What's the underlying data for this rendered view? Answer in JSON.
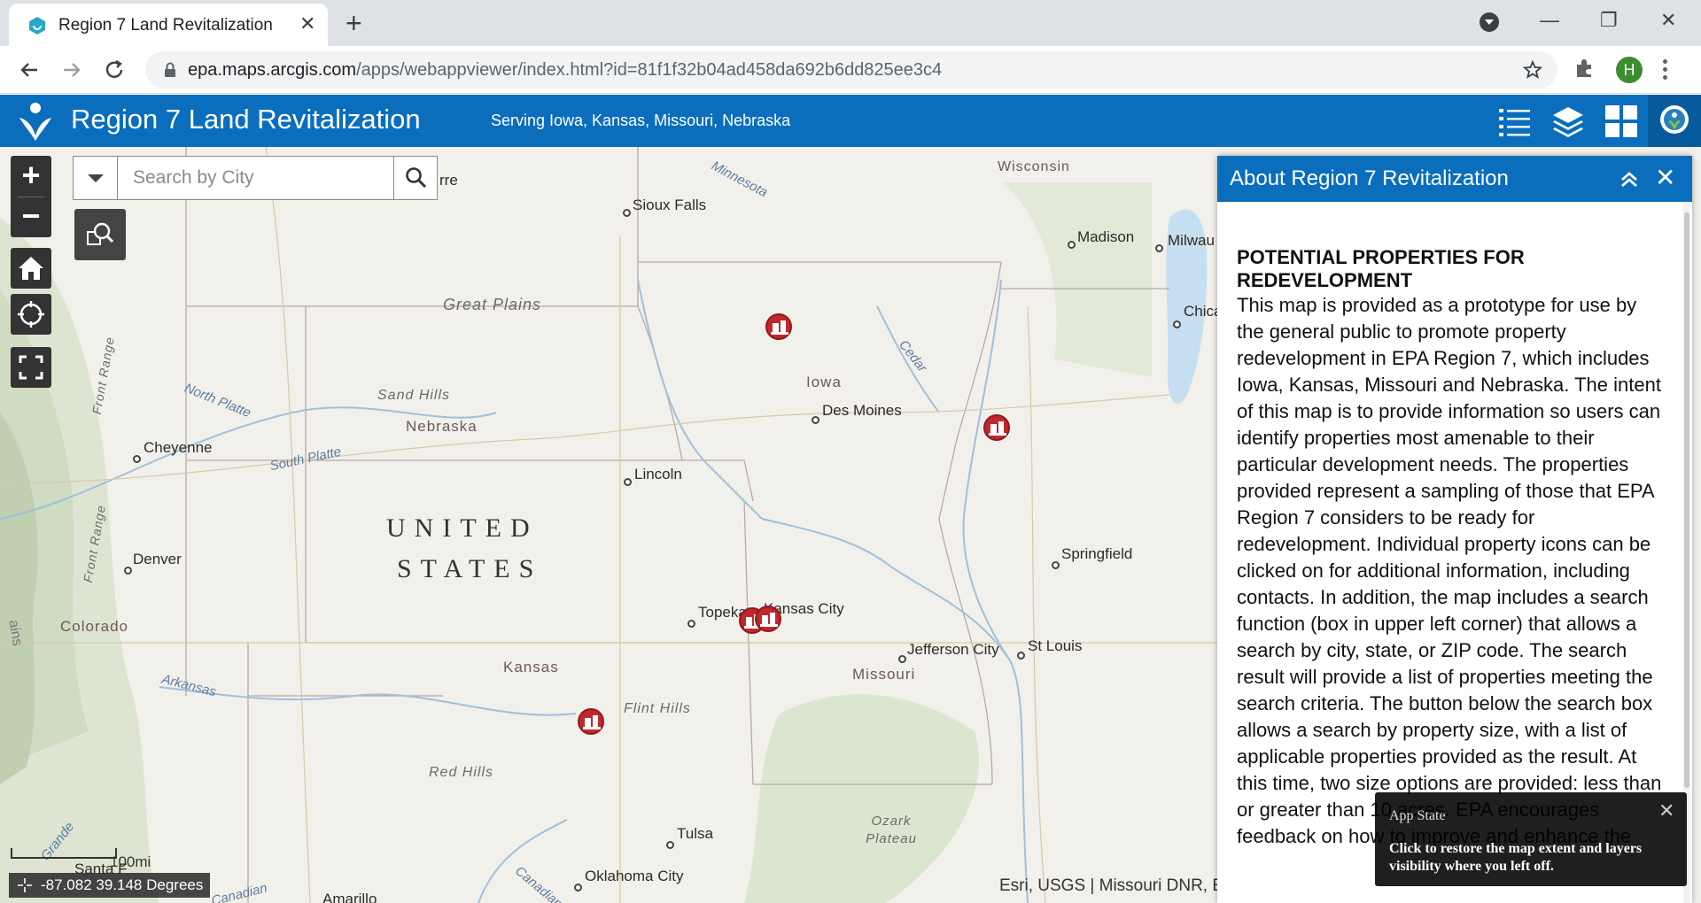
{
  "browser": {
    "tab_title": "Region 7 Land Revitalization",
    "url_host": "epa.maps.arcgis.com",
    "url_path": "/apps/webappviewer/index.html?id=81f1f32b04ad458da692b6dd825ee3c4",
    "profile_initial": "H"
  },
  "app": {
    "title": "Region 7 Land Revitalization",
    "subtitle": "Serving Iowa, Kansas, Missouri, Nebraska",
    "accent": "#0a6ebd"
  },
  "search": {
    "placeholder": "Search by City"
  },
  "map": {
    "cities": [
      "Sioux Falls",
      "Madison",
      "Milwau",
      "Chica",
      "Des Moines",
      "Cheyenne",
      "Lincoln",
      "Denver",
      "Springfield",
      "Topeka",
      "Kansas City",
      "Jefferson City",
      "St Louis",
      "Tulsa",
      "Oklahoma City",
      "Santa F",
      "Amarillo",
      "rre"
    ],
    "regions": [
      "Great Plains",
      "Sand Hills",
      "Flint Hills",
      "Red Hills",
      "Ozark Plateau",
      "Front Range",
      "Front Range",
      "Minnesota",
      "Wisconsin",
      "North Platte",
      "South Platte",
      "Arkansas",
      "Cedar",
      "Canadian",
      "Canadian",
      "Grande"
    ],
    "states": [
      "Iowa",
      "Nebraska",
      "Kansas",
      "Missouri",
      "Colorado"
    ],
    "country_line1": "UNITED",
    "country_line2": "STATES",
    "edge_labels": [
      "ains",
      "g"
    ],
    "scale": "100mi",
    "coordinates": "-87.082 39.148 Degrees",
    "attribution": "Esri, USGS | Missouri DNR, E",
    "marker_color": "#c1272d"
  },
  "about": {
    "title": "About Region 7 Revitalization",
    "heading": "POTENTIAL PROPERTIES FOR REDEVELOPMENT",
    "body": "This map is provided as a prototype for use by the general public to promote property redevelopment in EPA Region 7, which includes Iowa, Kansas, Missouri and Nebraska. The intent of this map is to provide information so users can identify properties most amenable to their particular development needs. The properties provided represent a sampling of those that EPA Region 7 considers to be ready for redevelopment. Individual property icons can be clicked on for additional information, including contacts. In addition, the map includes a search function (box in upper left corner) that allows a search by city, state, or ZIP code. The search result will provide a list of properties meeting the search criteria. The button below the search box allows a search by property size, with a list of applicable properties provided as the result. At this time, two size options are provided: less than or greater than 10 acres. EPA encourages feedback on how to improve and enhance the"
  },
  "toast": {
    "title": "App State",
    "message": "Click to restore the map extent and layers visibility where you left off."
  }
}
